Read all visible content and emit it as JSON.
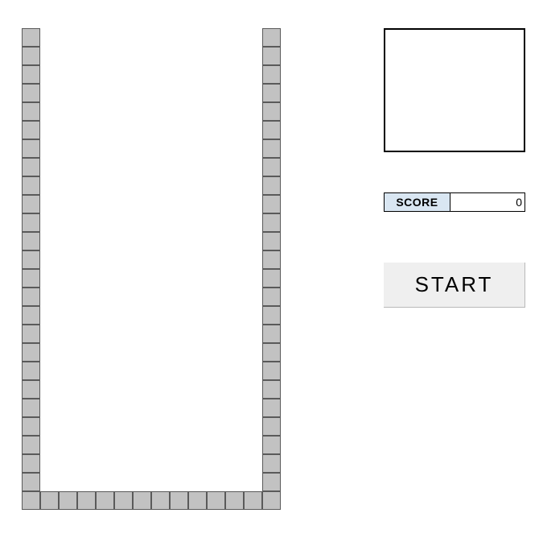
{
  "board": {
    "cols": 14,
    "rows": 26
  },
  "score": {
    "label": "SCORE",
    "value": "0"
  },
  "start_button_label": "START"
}
